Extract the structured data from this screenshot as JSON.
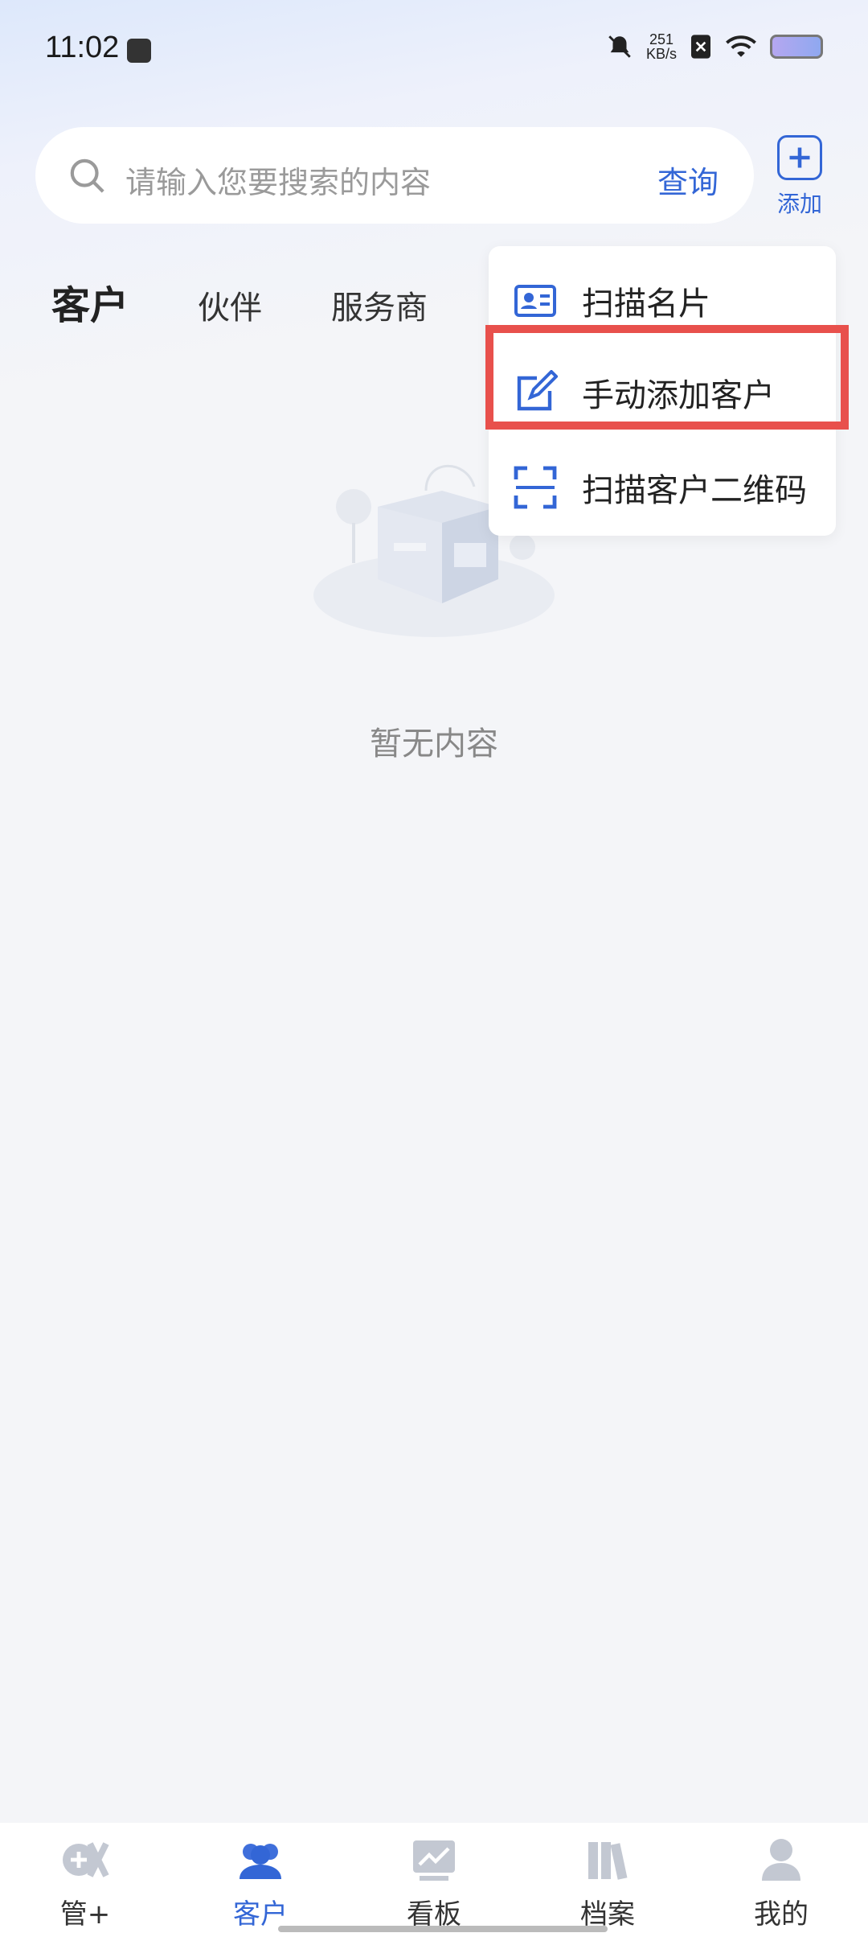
{
  "status_bar": {
    "time": "11:02",
    "speed_value": "251",
    "speed_unit": "KB/s"
  },
  "search": {
    "placeholder": "请输入您要搜索的内容",
    "query_label": "查询"
  },
  "add_button": {
    "label": "添加"
  },
  "tabs": [
    {
      "label": "客户",
      "active": true
    },
    {
      "label": "伙伴",
      "active": false
    },
    {
      "label": "服务商",
      "active": false
    }
  ],
  "empty_state": {
    "text": "暂无内容"
  },
  "dropdown": {
    "items": [
      {
        "label": "扫描名片",
        "icon": "business-card-icon"
      },
      {
        "label": "手动添加客户",
        "icon": "edit-icon"
      },
      {
        "label": "扫描客户二维码",
        "icon": "scan-qr-icon"
      }
    ],
    "highlighted_index": 1
  },
  "bottom_nav": {
    "items": [
      {
        "label": "管+",
        "icon": "manage-plus-icon"
      },
      {
        "label": "客户",
        "icon": "customers-icon",
        "active": true
      },
      {
        "label": "看板",
        "icon": "dashboard-icon"
      },
      {
        "label": "档案",
        "icon": "archive-icon"
      },
      {
        "label": "我的",
        "icon": "profile-icon"
      }
    ]
  },
  "colors": {
    "accent": "#3366d6",
    "highlight": "#e8504c"
  }
}
